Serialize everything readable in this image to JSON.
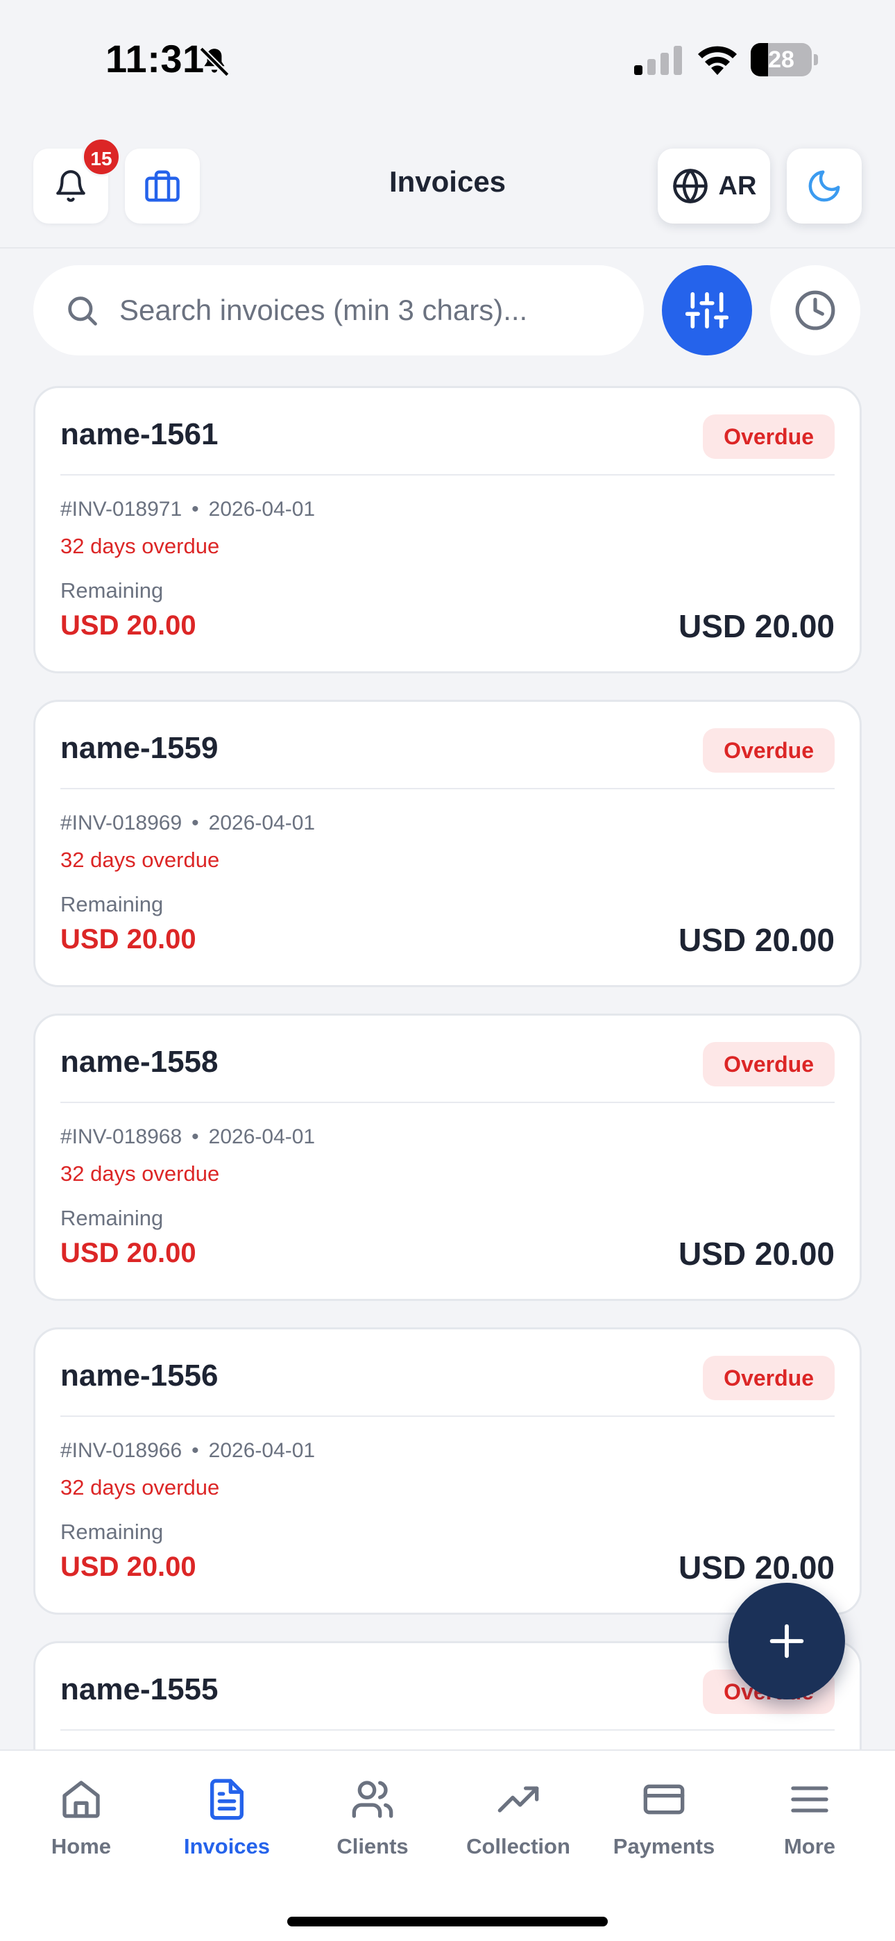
{
  "status_bar": {
    "time": "11:31",
    "battery": "28",
    "battery_level": 0.28
  },
  "header": {
    "title": "Invoices",
    "notification_count": "15",
    "language": "AR"
  },
  "search": {
    "placeholder": "Search invoices (min 3 chars)..."
  },
  "invoices": [
    {
      "name": "name-1561",
      "status": "Overdue",
      "number": "#INV-018971",
      "date": "2026-04-01",
      "overdue_text": "32 days overdue",
      "remaining_label": "Remaining",
      "remaining": "USD 20.00",
      "amount": "USD 20.00"
    },
    {
      "name": "name-1559",
      "status": "Overdue",
      "number": "#INV-018969",
      "date": "2026-04-01",
      "overdue_text": "32 days overdue",
      "remaining_label": "Remaining",
      "remaining": "USD 20.00",
      "amount": "USD 20.00"
    },
    {
      "name": "name-1558",
      "status": "Overdue",
      "number": "#INV-018968",
      "date": "2026-04-01",
      "overdue_text": "32 days overdue",
      "remaining_label": "Remaining",
      "remaining": "USD 20.00",
      "amount": "USD 20.00"
    },
    {
      "name": "name-1556",
      "status": "Overdue",
      "number": "#INV-018966",
      "date": "2026-04-01",
      "overdue_text": "32 days overdue",
      "remaining_label": "Remaining",
      "remaining": "USD 20.00",
      "amount": "USD 20.00"
    },
    {
      "name": "name-1555",
      "status": "Overdue"
    }
  ],
  "tabs": [
    {
      "label": "Home",
      "icon": "home-icon",
      "active": false
    },
    {
      "label": "Invoices",
      "icon": "document-icon",
      "active": true
    },
    {
      "label": "Clients",
      "icon": "users-icon",
      "active": false
    },
    {
      "label": "Collection",
      "icon": "trending-up-icon",
      "active": false
    },
    {
      "label": "Payments",
      "icon": "credit-card-icon",
      "active": false
    },
    {
      "label": "More",
      "icon": "menu-icon",
      "active": false
    }
  ],
  "colors": {
    "accent": "#2563eb",
    "danger": "#dc2626",
    "fab": "#1b3158",
    "background": "#f3f4f7"
  }
}
